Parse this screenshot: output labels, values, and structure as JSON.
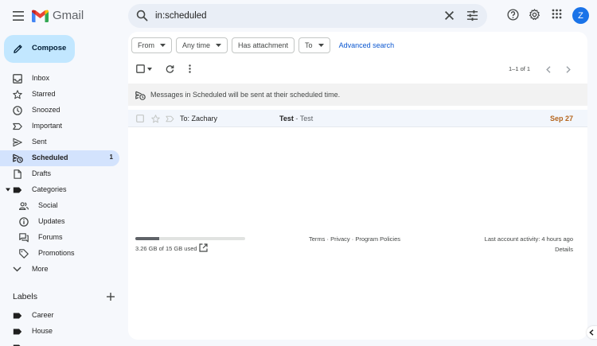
{
  "app": {
    "name": "Gmail"
  },
  "search": {
    "query": "in:scheduled"
  },
  "user": {
    "initial": "Z"
  },
  "compose": {
    "label": "Compose"
  },
  "nav": {
    "items": [
      {
        "label": "Inbox",
        "icon": "inbox-icon"
      },
      {
        "label": "Starred",
        "icon": "star-icon"
      },
      {
        "label": "Snoozed",
        "icon": "clock-icon"
      },
      {
        "label": "Important",
        "icon": "label-important-icon"
      },
      {
        "label": "Sent",
        "icon": "send-icon"
      },
      {
        "label": "Scheduled",
        "icon": "scheduled-send-icon",
        "count": "1",
        "active": true
      },
      {
        "label": "Drafts",
        "icon": "draft-icon"
      },
      {
        "label": "Categories",
        "icon": "label-icon"
      },
      {
        "label": "Social",
        "icon": "people-icon"
      },
      {
        "label": "Updates",
        "icon": "info-icon"
      },
      {
        "label": "Forums",
        "icon": "forum-icon"
      },
      {
        "label": "Promotions",
        "icon": "tag-icon"
      },
      {
        "label": "More",
        "icon": "chevron-down-icon"
      }
    ]
  },
  "labels": {
    "heading": "Labels",
    "items": [
      {
        "label": "Career"
      },
      {
        "label": "House"
      }
    ]
  },
  "filters": {
    "from": "From",
    "any_time": "Any time",
    "has_attachment": "Has attachment",
    "to": "To",
    "advanced_search": "Advanced search"
  },
  "pager": {
    "text": "1–1 of 1"
  },
  "banner": {
    "text": "Messages in Scheduled will be sent at their scheduled time."
  },
  "messages": [
    {
      "recipient": "To: Zachary",
      "subject": "Test",
      "snippet": "Test",
      "date": "Sep 27"
    }
  ],
  "footer": {
    "storage_used_fraction": 0.217,
    "storage_text": "3.26 GB of 15 GB used",
    "links": "Terms · Privacy · Program Policies",
    "activity": "Last account activity: 4 hours ago",
    "details": "Details"
  },
  "colors": {
    "accent": "#0b57d0",
    "compose_bg": "#c2e7ff",
    "active_nav_bg": "#d3e3fd",
    "scheduled_date": "#b5651d"
  }
}
